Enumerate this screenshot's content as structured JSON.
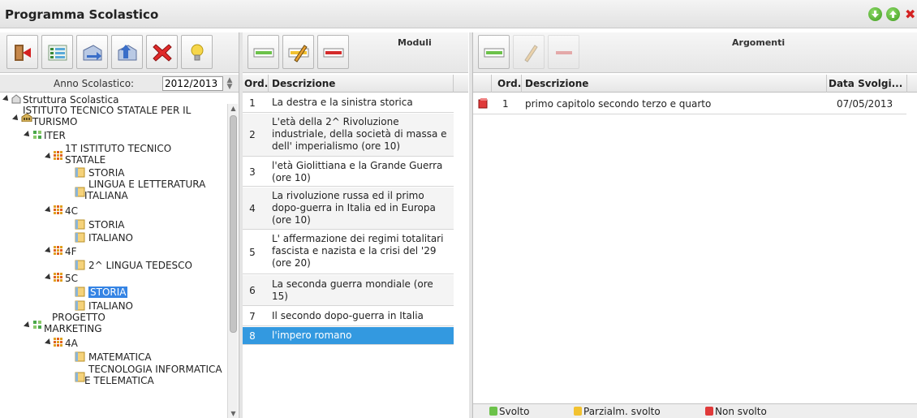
{
  "window": {
    "title": "Programma Scolastico",
    "controls": [
      "arrow-down-green-icon",
      "arrow-up-green-icon",
      "close-red-icon"
    ]
  },
  "left_toolbar": {
    "buttons": [
      "exit-icon",
      "list-view-icon",
      "export-icon",
      "import-icon",
      "delete-x-icon",
      "lightbulb-icon"
    ]
  },
  "year_selector": {
    "label": "Anno Scolastico:",
    "value": "2012/2013"
  },
  "tree": [
    {
      "label": "Struttura Scolastica",
      "icon": "school-icon"
    },
    {
      "label": "ISTITUTO TECNICO STATALE PER IL",
      "label2": "TURISMO",
      "icon": "building-icon"
    },
    {
      "label": "ITER",
      "icon": "group-icon"
    },
    {
      "label": "1T ISTITUTO TECNICO",
      "label2": "STATALE",
      "icon": "class-icon"
    },
    {
      "label": "STORIA",
      "icon": "book-icon"
    },
    {
      "label": "LINGUA E LETTERATURA",
      "label2": "ITALIANA",
      "icon": "book-icon"
    },
    {
      "label": "4C",
      "icon": "class-icon"
    },
    {
      "label": "STORIA",
      "icon": "book-icon"
    },
    {
      "label": "ITALIANO",
      "icon": "book-icon"
    },
    {
      "label": "4F",
      "icon": "class-icon"
    },
    {
      "label": "2^ LINGUA TEDESCO",
      "icon": "book-icon"
    },
    {
      "label": "5C",
      "icon": "class-icon"
    },
    {
      "label": "STORIA",
      "icon": "book-icon",
      "selected": true
    },
    {
      "label": "ITALIANO",
      "icon": "book-icon"
    },
    {
      "label": "PROGETTO",
      "label2": "MARKETING",
      "icon": "group-icon"
    },
    {
      "label": "4A",
      "icon": "class-icon"
    },
    {
      "label": "MATEMATICA",
      "icon": "book-icon"
    },
    {
      "label": "TECNOLOGIA INFORMATICA",
      "label2": "E TELEMATICA",
      "icon": "book-icon"
    }
  ],
  "moduli": {
    "heading": "Moduli",
    "toolbar": [
      "add-row-icon",
      "edit-row-icon",
      "remove-row-icon"
    ],
    "columns": {
      "ord": "Ord.",
      "desc": "Descrizione"
    },
    "rows": [
      {
        "ord": "1",
        "desc": "La destra e la sinistra storica"
      },
      {
        "ord": "2",
        "desc": "L'età della 2^ Rivoluzione industriale, della società di massa e dell' imperialismo (ore 10)"
      },
      {
        "ord": "3",
        "desc": "l'età Giolittiana e la Grande Guerra (ore 10)"
      },
      {
        "ord": "4",
        "desc": "La rivoluzione russa ed il primo dopo-guerra in Italia ed in Europa (ore 10)"
      },
      {
        "ord": "5",
        "desc": "L' affermazione dei regimi totalitari fascista e nazista e la crisi del '29 (ore 20)"
      },
      {
        "ord": "6",
        "desc": "La seconda guerra mondiale (ore 15)"
      },
      {
        "ord": "7",
        "desc": "Il secondo dopo-guerra in Italia"
      },
      {
        "ord": "8",
        "desc": "l'impero romano",
        "selected": true
      }
    ]
  },
  "argomenti": {
    "heading": "Argomenti",
    "toolbar": [
      "add-row-icon",
      "edit-row-icon",
      "remove-row-icon"
    ],
    "columns": {
      "ord": "Ord.",
      "desc": "Descrizione",
      "date": "Data Svolgi..."
    },
    "rows": [
      {
        "status_icon": "red-book-icon",
        "ord": "1",
        "desc": "primo capitolo secondo terzo e quarto",
        "date": "07/05/2013"
      }
    ],
    "legend": [
      {
        "label": "Svolto",
        "color": "#6cc24a"
      },
      {
        "label": "Parzialm. svolto",
        "color": "#f2c230"
      },
      {
        "label": "Non svolto",
        "color": "#e03a3a"
      }
    ]
  }
}
